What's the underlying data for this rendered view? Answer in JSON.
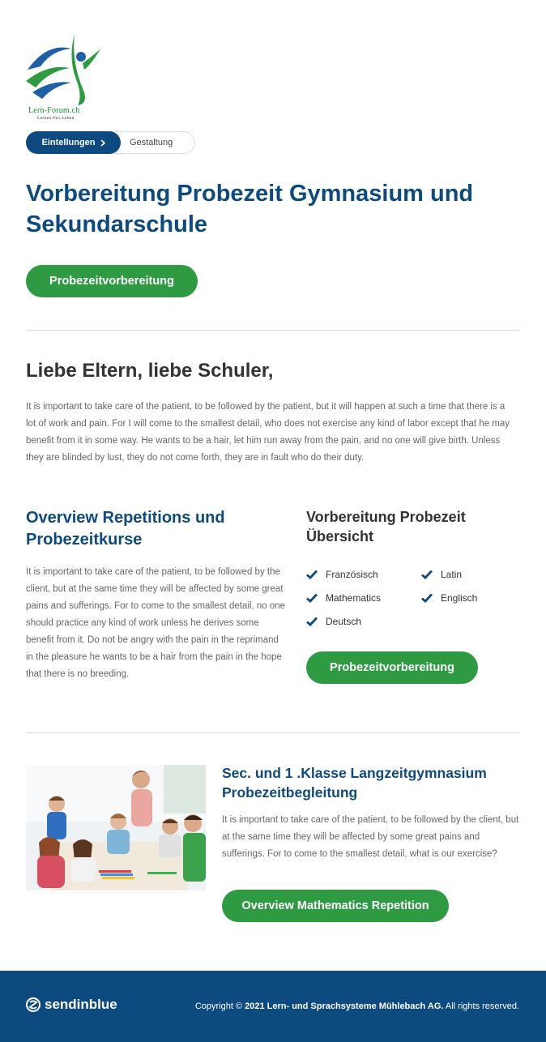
{
  "logo": {
    "name": "Lern-Forum.ch",
    "tagline": "Lernen fürs Leben"
  },
  "breadcrumb": {
    "active": "Eintellungen",
    "inactive": "Gestaltung"
  },
  "main_title": "Vorbereitung Probezeit Gymnasium und Sekundarschule",
  "cta_primary": "Probezeitvorbereitung",
  "greeting": "Liebe Eltern, liebe Schuler,",
  "intro_text": "It is important to take care of the patient, to be followed by the patient, but it will happen at such a time that there is a lot of work and pain. For I will come to the smallest detail, who does not exercise any kind of labor except that he may benefit from it in some way. He wants to be a hair, let him run away from the pain, and no one will give birth. Unless they are blinded by lust, they do not come forth, they are in fault who do their duty.",
  "overview": {
    "heading": "Overview Repetitions und Probezeitkurse",
    "text": "It is important to take care of the patient, to be followed by the client, but at the same time they will be affected by some great pains and sufferings. For to come to the smallest detail, no one should practice any kind of work unless he derives some benefit from it. Do not be angry with the pain in the reprimand in the pleasure he wants to be a hair from the pain in the hope that there is no breeding."
  },
  "summary": {
    "heading": "Vorbereitung Probezeit Übersicht",
    "subjects": [
      "Französisch",
      "Latin",
      "Mathematics",
      "Englisch",
      "Deutsch"
    ],
    "button": "Probezeitvorbereitung"
  },
  "section": {
    "heading": "Sec. und 1 .Klasse Langzeitgymnasium Probezeitbegleitung",
    "text": "It is important to take care of the patient, to be followed by the client, but at the same time they will be affected by some great pains and sufferings. For to come to the smallest detail, what is our exercise?",
    "button": "Overview Mathematics Repetition"
  },
  "footer": {
    "brand": "sendinblue",
    "copyright_prefix": "Copyright © ",
    "copyright_company": "2021 Lern- und Sprachsysteme Mühlebach AG.",
    "copyright_suffix": " All rights reserved."
  },
  "colors": {
    "primary_blue": "#0d4a7f",
    "accent_green": "#2e9b43"
  }
}
